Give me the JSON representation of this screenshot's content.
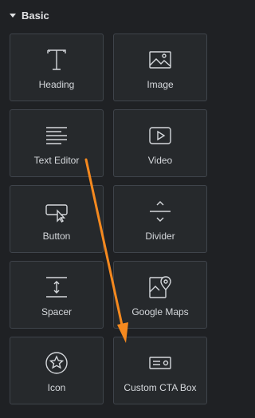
{
  "section": {
    "title": "Basic"
  },
  "widgets": [
    {
      "label": "Heading",
      "icon": "heading-icon"
    },
    {
      "label": "Image",
      "icon": "image-icon"
    },
    {
      "label": "Text Editor",
      "icon": "text-editor-icon"
    },
    {
      "label": "Video",
      "icon": "video-icon"
    },
    {
      "label": "Button",
      "icon": "button-icon"
    },
    {
      "label": "Divider",
      "icon": "divider-icon"
    },
    {
      "label": "Spacer",
      "icon": "spacer-icon"
    },
    {
      "label": "Google Maps",
      "icon": "google-maps-icon"
    },
    {
      "label": "Icon",
      "icon": "star-icon"
    },
    {
      "label": "Custom CTA Box",
      "icon": "cta-box-icon"
    }
  ],
  "colors": {
    "background": "#1f2124",
    "tile": "#26292c",
    "tile_border": "#3f444b",
    "text": "#d5d8dc",
    "annotation_arrow": "#f5891f"
  }
}
